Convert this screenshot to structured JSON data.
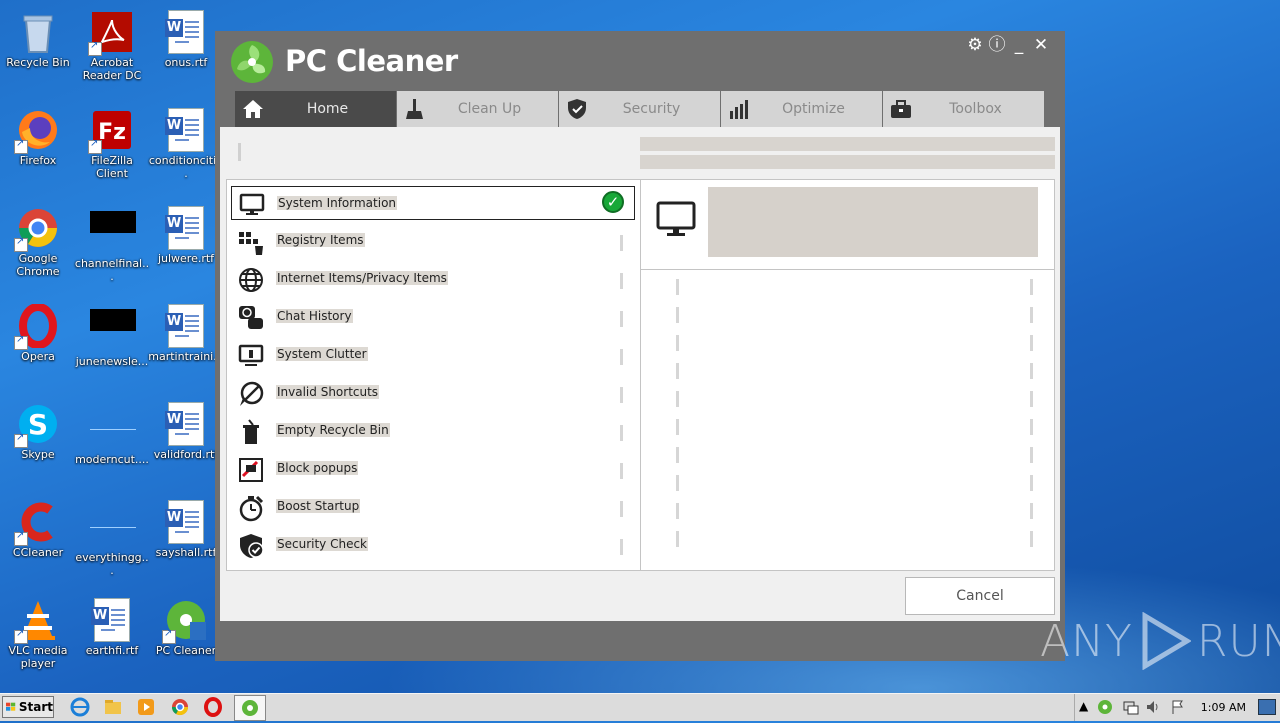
{
  "desktop": {
    "icons": [
      {
        "label": "Recycle Bin",
        "kind": "recycle-bin"
      },
      {
        "label": "Acrobat Reader DC",
        "kind": "acrobat"
      },
      {
        "label": "onus.rtf",
        "kind": "word-doc"
      },
      {
        "label": "Firefox",
        "kind": "firefox"
      },
      {
        "label": "FileZilla Client",
        "kind": "filezilla"
      },
      {
        "label": "conditionciti...",
        "kind": "word-doc"
      },
      {
        "label": "Google Chrome",
        "kind": "chrome"
      },
      {
        "label": "channelfinal...",
        "kind": "black-file"
      },
      {
        "label": "julwere.rtf",
        "kind": "word-doc"
      },
      {
        "label": "Opera",
        "kind": "opera"
      },
      {
        "label": "junenewsle...",
        "kind": "black-file"
      },
      {
        "label": "martintraini...",
        "kind": "word-doc"
      },
      {
        "label": "Skype",
        "kind": "skype"
      },
      {
        "label": "moderncut....",
        "kind": "blank-file"
      },
      {
        "label": "validford.rtf",
        "kind": "word-doc"
      },
      {
        "label": "CCleaner",
        "kind": "ccleaner"
      },
      {
        "label": "everythingg...",
        "kind": "blank-file"
      },
      {
        "label": "sayshall.rtf",
        "kind": "word-doc"
      },
      {
        "label": "VLC media player",
        "kind": "vlc"
      },
      {
        "label": "earthfi.rtf",
        "kind": "word-doc"
      },
      {
        "label": "PC Cleaner",
        "kind": "pc-cleaner"
      }
    ]
  },
  "app": {
    "title": "PC Cleaner",
    "tabs": [
      {
        "label": "Home",
        "icon": "home-icon"
      },
      {
        "label": "Clean Up",
        "icon": "broom-icon"
      },
      {
        "label": "Security",
        "icon": "shield-icon"
      },
      {
        "label": "Optimize",
        "icon": "bar-chart-icon"
      },
      {
        "label": "Toolbox",
        "icon": "toolbox-icon"
      }
    ],
    "scan_items": [
      {
        "label": "System Information",
        "icon": "monitor-icon",
        "done": true
      },
      {
        "label": "Registry Items",
        "icon": "registry-icon",
        "done": false
      },
      {
        "label": "Internet Items/Privacy Items",
        "icon": "globe-icon",
        "done": false
      },
      {
        "label": "Chat History",
        "icon": "chat-icon",
        "done": false
      },
      {
        "label": "System Clutter",
        "icon": "clutter-icon",
        "done": false
      },
      {
        "label": "Invalid Shortcuts",
        "icon": "broken-shortcut-icon",
        "done": false
      },
      {
        "label": "Empty Recycle Bin",
        "icon": "trash-icon",
        "done": false
      },
      {
        "label": "Block popups",
        "icon": "popup-icon",
        "done": false
      },
      {
        "label": "Boost Startup",
        "icon": "stopwatch-icon",
        "done": false
      },
      {
        "label": "Security Check",
        "icon": "shield-check-icon",
        "done": false
      }
    ],
    "cancel_label": "Cancel"
  },
  "watermark": {
    "text_left": "ANY",
    "text_right": "RUN"
  },
  "taskbar": {
    "start_label": "Start",
    "clock": "1:09 AM"
  },
  "colors": {
    "check_green": "#18a838",
    "logo_green": "#5db53a",
    "window_gray": "#6f6f6f"
  }
}
